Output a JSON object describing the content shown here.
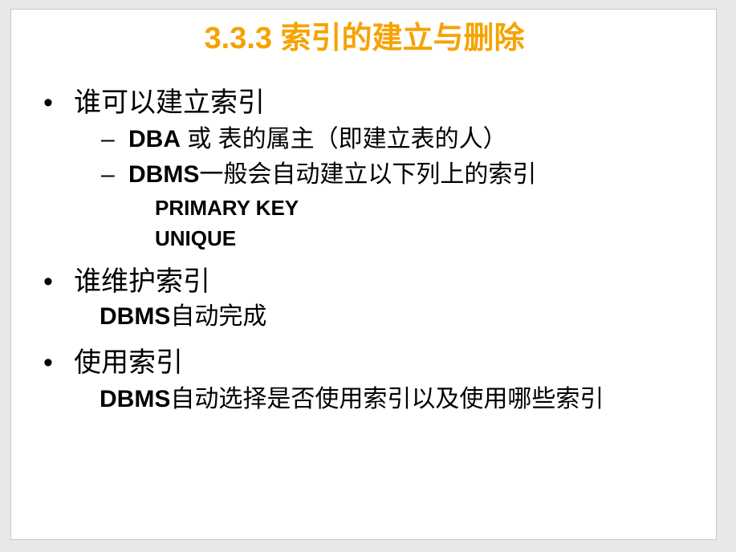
{
  "title": "3.3.3 索引的建立与删除",
  "bullet_glyph": "•",
  "dash_glyph": "–",
  "items": [
    {
      "text": "谁可以建立索引",
      "subs": [
        {
          "bold": "DBA",
          "rest": " 或 表的属主（即建立表的人）"
        },
        {
          "bold": "DBMS",
          "rest": "一般会自动建立以下列上的索引"
        }
      ],
      "subsubs": [
        "PRIMARY  KEY",
        "UNIQUE"
      ]
    },
    {
      "text": "谁维护索引",
      "detail": {
        "bold": "DBMS",
        "rest": "自动完成"
      }
    },
    {
      "text": "使用索引",
      "detail": {
        "bold": "DBMS",
        "rest": "自动选择是否使用索引以及使用哪些索引"
      }
    }
  ],
  "colors": {
    "title": "#f5a300",
    "text": "#000000",
    "slide_bg": "#ffffff",
    "window_bg": "#e8e8e8"
  }
}
